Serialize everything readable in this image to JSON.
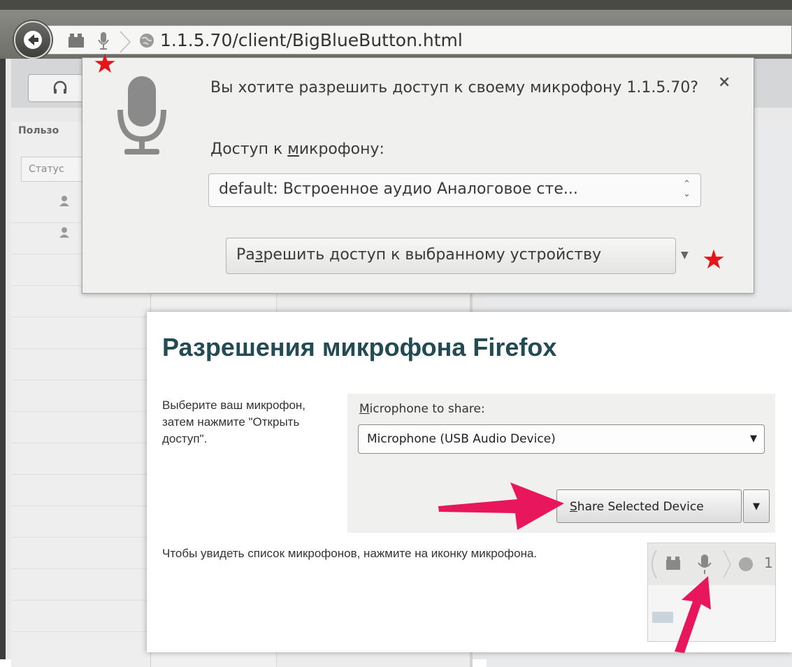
{
  "browser": {
    "url": "1.1.5.70/client/BigBlueButton.html",
    "icons": [
      "back-icon",
      "addons-icon",
      "microphone-icon",
      "chevron-right-icon",
      "globe-icon"
    ]
  },
  "bbb": {
    "users_title": "Пользо",
    "status_header": "Статус",
    "icons": [
      "headset-icon",
      "user-icon"
    ]
  },
  "doorhanger": {
    "question": "Вы хотите разрешить доступ к своему микрофону 1.1.5.70?",
    "close": "×",
    "mic_label_pre": "Доступ к ",
    "mic_label_u": "м",
    "mic_label_post": "икрофону:",
    "selected_device": "default: Встроенное аудио Аналоговое сте...",
    "allow_pre": "Ра",
    "allow_u": "з",
    "allow_post": "решить доступ к выбранному устройству",
    "star_color": "#e8141a"
  },
  "panel": {
    "title": "Разрешения микрофона Firefox",
    "instruction": "Выберите ваш микрофон, затем нажмите \"Открыть доступ\".",
    "mic_to_share_u": "M",
    "mic_to_share_rest": "icrophone to share:",
    "selected_mic": "Microphone (USB Audio Device)",
    "share_u": "S",
    "share_rest": "hare Selected Device",
    "hint": "Чтобы увидеть список микрофонов, нажмите на иконку микрофона.",
    "mini_url_fragment": "1",
    "arrow_color": "#e8175d"
  }
}
